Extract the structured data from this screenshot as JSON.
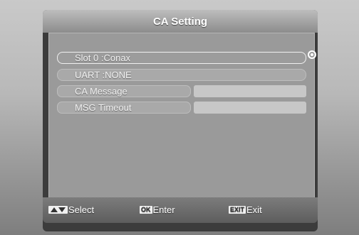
{
  "title": "CA Setting",
  "menu": {
    "items": [
      {
        "label": "Slot 0 :Conax"
      },
      {
        "label": "UART :NONE"
      },
      {
        "label": "CA Message"
      },
      {
        "label": "MSG Timeout"
      }
    ]
  },
  "footer": {
    "select": {
      "key": "",
      "label": "Select",
      "icon": "up-down-arrows-icon"
    },
    "enter": {
      "key": "OK",
      "label": "Enter"
    },
    "exit": {
      "key": "EXIT",
      "label": "Exit"
    }
  }
}
